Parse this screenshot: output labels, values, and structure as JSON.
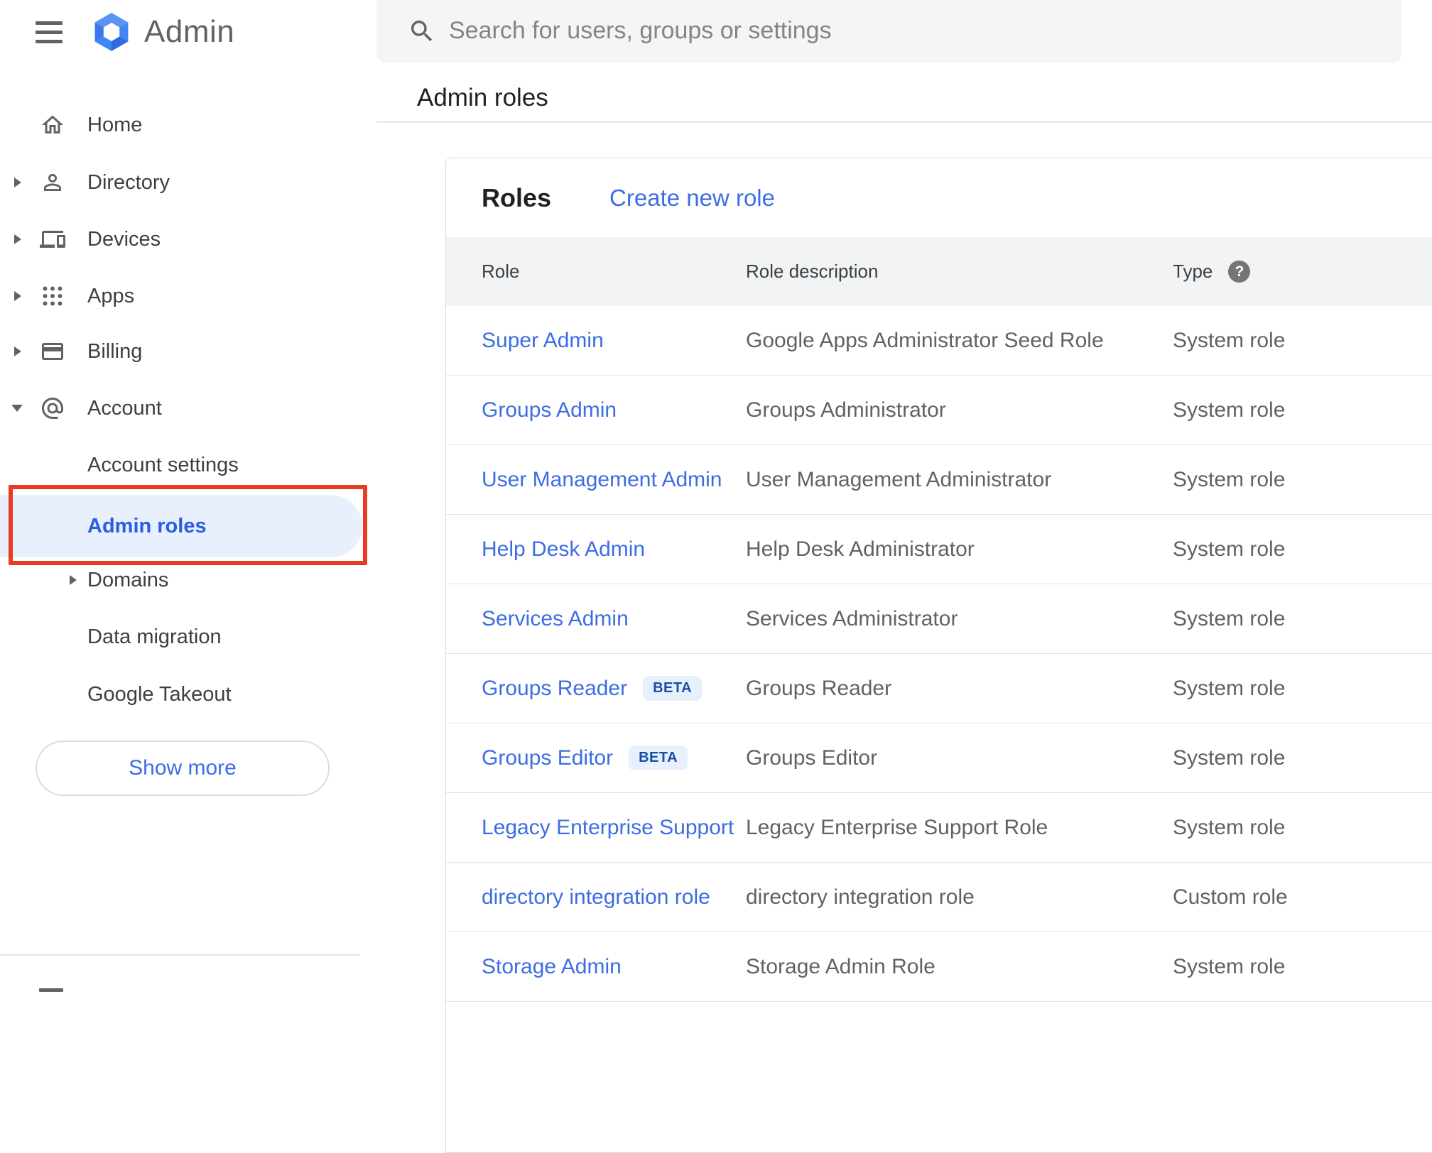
{
  "app": {
    "name": "Admin"
  },
  "search": {
    "placeholder": "Search for users, groups or settings"
  },
  "breadcrumb": "Admin roles",
  "sidebar": {
    "items": [
      {
        "label": "Home",
        "icon": "home-icon"
      },
      {
        "label": "Directory",
        "icon": "person-icon",
        "expandable": true
      },
      {
        "label": "Devices",
        "icon": "devices-icon",
        "expandable": true
      },
      {
        "label": "Apps",
        "icon": "apps-grid-icon",
        "expandable": true
      },
      {
        "label": "Billing",
        "icon": "credit-card-icon",
        "expandable": true
      },
      {
        "label": "Account",
        "icon": "at-sign-icon",
        "expanded": true
      },
      {
        "label": "Account settings",
        "indent": true
      },
      {
        "label": "Admin roles",
        "indent": true,
        "selected": true
      },
      {
        "label": "Domains",
        "indent": true,
        "expandable": true
      },
      {
        "label": "Data migration",
        "indent": true
      },
      {
        "label": "Google Takeout",
        "indent": true
      }
    ],
    "show_more_label": "Show more"
  },
  "panel": {
    "title": "Roles",
    "create_link": "Create new role",
    "columns": [
      "Role",
      "Role description",
      "Type"
    ],
    "rows": [
      {
        "role": "Super Admin",
        "beta": null,
        "description": "Google Apps Administrator Seed Role",
        "type": "System role"
      },
      {
        "role": "Groups Admin",
        "beta": null,
        "description": "Groups Administrator",
        "type": "System role"
      },
      {
        "role": "User Management Admin",
        "beta": null,
        "description": "User Management Administrator",
        "type": "System role"
      },
      {
        "role": "Help Desk Admin",
        "beta": null,
        "description": "Help Desk Administrator",
        "type": "System role"
      },
      {
        "role": "Services Admin",
        "beta": null,
        "description": "Services Administrator",
        "type": "System role"
      },
      {
        "role": "Groups Reader",
        "beta": "BETA",
        "description": "Groups Reader",
        "type": "System role"
      },
      {
        "role": "Groups Editor",
        "beta": "BETA",
        "description": "Groups Editor",
        "type": "System role"
      },
      {
        "role": "Legacy Enterprise Support",
        "beta": null,
        "description": "Legacy Enterprise Support Role",
        "type": "System role"
      },
      {
        "role": "directory integration role",
        "beta": null,
        "description": "directory integration role",
        "type": "Custom role"
      },
      {
        "role": "Storage Admin",
        "beta": null,
        "description": "Storage Admin Role",
        "type": "System role"
      }
    ]
  },
  "colors": {
    "link_blue": "#3d6de4",
    "selected_blue": "#2b5ce2",
    "beta_text": "#174ea6",
    "beta_bg": "#e8f0fe",
    "annotation_red": "#e93b22",
    "logo_blue": "#4285f4"
  }
}
